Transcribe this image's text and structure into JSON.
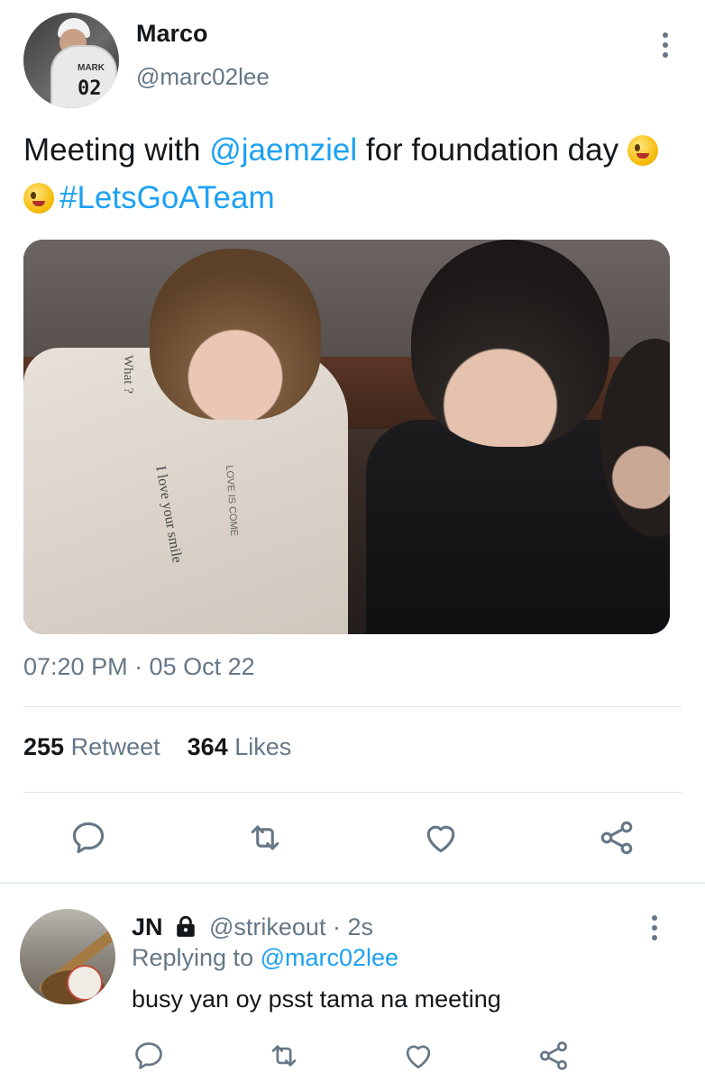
{
  "tweet": {
    "author_name": "Marco",
    "author_handle": "@marc02lee",
    "avatar_jersey_name": "MARK",
    "avatar_jersey_number": "02",
    "text_part1": "Meeting with ",
    "mention": "@jaemziel",
    "text_part2": " for foundation day ",
    "hashtag": "#LetsGoATeam",
    "photo_texts": [
      "What ?",
      "I love your smile",
      "LOVE IS COME"
    ],
    "timestamp": "07:20 PM · 05 Oct 22",
    "retweet_count": "255",
    "retweet_label": "Retweet",
    "likes_count": "364",
    "likes_label": "Likes"
  },
  "reply": {
    "author_name": "JN",
    "author_handle": "@strikeout · 2s",
    "replying_label": "Replying to ",
    "replying_handle": "@marc02lee",
    "text": "busy yan oy psst tama na meeting"
  },
  "icons": [
    "more-icon",
    "reply-icon",
    "retweet-icon",
    "like-icon",
    "share-icon",
    "lock-icon",
    "emoji-zany-icon",
    "emoji-starstruck-icon"
  ],
  "colors": {
    "link": "#1da1f2",
    "secondary": "#657786",
    "text": "#14171a"
  }
}
